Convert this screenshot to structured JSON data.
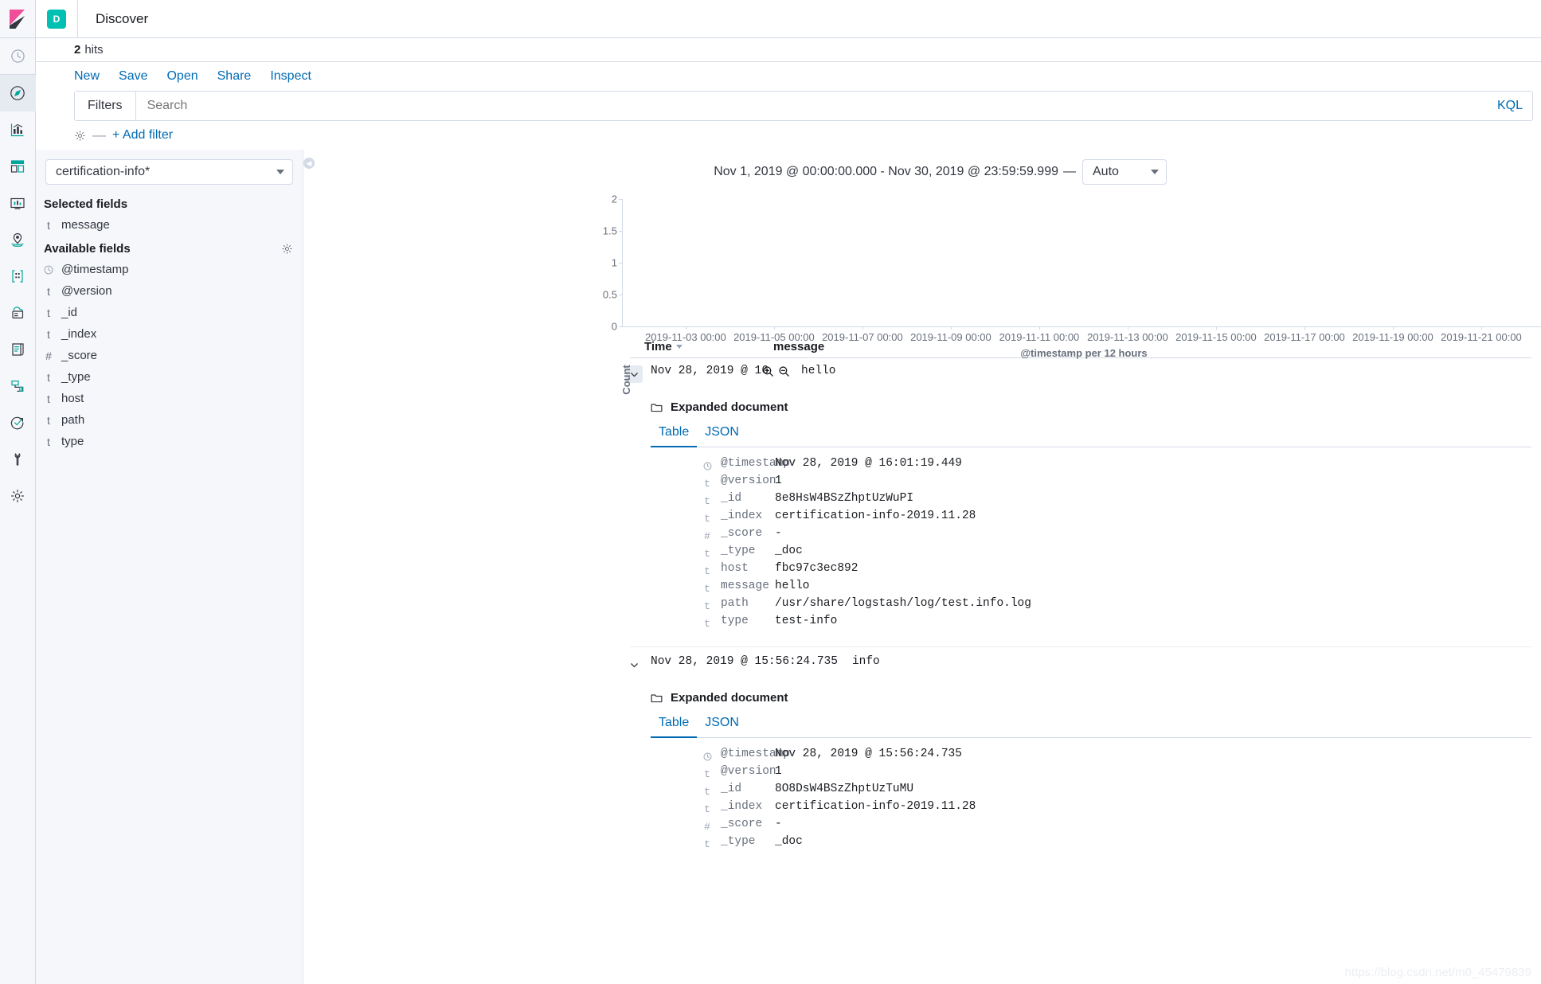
{
  "app": {
    "logo": "kibana-logo",
    "space_badge": "D",
    "title": "Discover"
  },
  "hits": {
    "count": "2",
    "label": "hits"
  },
  "actions": [
    {
      "label": "New",
      "name": "new"
    },
    {
      "label": "Save",
      "name": "save"
    },
    {
      "label": "Open",
      "name": "open"
    },
    {
      "label": "Share",
      "name": "share"
    },
    {
      "label": "Inspect",
      "name": "inspect"
    }
  ],
  "query_bar": {
    "filters_label": "Filters",
    "search_placeholder": "Search",
    "search_value": "",
    "language_label": "KQL"
  },
  "filter_row": {
    "add_filter_label": "+ Add filter",
    "dash": "—"
  },
  "sidebar": {
    "index_pattern": "certification-info*",
    "selected_fields_title": "Selected fields",
    "selected_fields": [
      {
        "type": "t",
        "name": "message"
      }
    ],
    "available_fields_title": "Available fields",
    "available_fields": [
      {
        "type": "clock",
        "name": "@timestamp"
      },
      {
        "type": "t",
        "name": "@version"
      },
      {
        "type": "t",
        "name": "_id"
      },
      {
        "type": "t",
        "name": "_index"
      },
      {
        "type": "#",
        "name": "_score"
      },
      {
        "type": "t",
        "name": "_type"
      },
      {
        "type": "t",
        "name": "host"
      },
      {
        "type": "t",
        "name": "path"
      },
      {
        "type": "t",
        "name": "type"
      }
    ]
  },
  "timepicker": {
    "range": "Nov 1, 2019 @ 00:00:00.000 - Nov 30, 2019 @ 23:59:59.999",
    "separator": "—",
    "interval": "Auto"
  },
  "chart_data": {
    "type": "bar",
    "title": "",
    "xlabel": "@timestamp per 12 hours",
    "ylabel": "Count",
    "ylim": [
      0,
      2
    ],
    "yticks": [
      "0",
      "0.5",
      "1",
      "1.5",
      "2"
    ],
    "ytick_values": [
      0,
      0.5,
      1,
      1.5,
      2
    ],
    "xticks": [
      "2019-11-03 00:00",
      "2019-11-05 00:00",
      "2019-11-07 00:00",
      "2019-11-09 00:00",
      "2019-11-11 00:00",
      "2019-11-13 00:00",
      "2019-11-15 00:00",
      "2019-11-17 00:00",
      "2019-11-19 00:00",
      "2019-11-21 00:00"
    ],
    "categories": [],
    "values": [],
    "grid": false,
    "legend": "none"
  },
  "doc_table": {
    "columns": [
      {
        "label": "Time",
        "name": "time",
        "sorted": true
      },
      {
        "label": "message",
        "name": "message",
        "sorted": false
      }
    ],
    "rows": [
      {
        "time_display": "Nov 28, 2019 @ 16:01:1",
        "message": "hello",
        "show_filter_icons": true,
        "expanded": {
          "title": "Expanded document",
          "tabs": [
            {
              "label": "Table",
              "active": true
            },
            {
              "label": "JSON",
              "active": false
            }
          ],
          "fields": [
            {
              "icon": "clock",
              "name": "@timestamp",
              "value": "Nov 28, 2019 @ 16:01:19.449"
            },
            {
              "icon": "t",
              "name": "@version",
              "value": "1"
            },
            {
              "icon": "t",
              "name": "_id",
              "value": "8e8HsW4BSzZhptUzWuPI"
            },
            {
              "icon": "t",
              "name": "_index",
              "value": "certification-info-2019.11.28"
            },
            {
              "icon": "#",
              "name": "_score",
              "value": "-"
            },
            {
              "icon": "t",
              "name": "_type",
              "value": "_doc"
            },
            {
              "icon": "t",
              "name": "host",
              "value": "fbc97c3ec892"
            },
            {
              "icon": "t",
              "name": "message",
              "value": "hello"
            },
            {
              "icon": "t",
              "name": "path",
              "value": "/usr/share/logstash/log/test.info.log"
            },
            {
              "icon": "t",
              "name": "type",
              "value": "test-info"
            }
          ]
        }
      },
      {
        "time_display": "Nov 28, 2019 @ 15:56:24.735",
        "message": "info",
        "show_filter_icons": false,
        "expanded": {
          "title": "Expanded document",
          "tabs": [
            {
              "label": "Table",
              "active": true
            },
            {
              "label": "JSON",
              "active": false
            }
          ],
          "fields": [
            {
              "icon": "clock",
              "name": "@timestamp",
              "value": "Nov 28, 2019 @ 15:56:24.735"
            },
            {
              "icon": "t",
              "name": "@version",
              "value": "1"
            },
            {
              "icon": "t",
              "name": "_id",
              "value": "8O8DsW4BSzZhptUzTuMU"
            },
            {
              "icon": "t",
              "name": "_index",
              "value": "certification-info-2019.11.28"
            },
            {
              "icon": "#",
              "name": "_score",
              "value": "-"
            },
            {
              "icon": "t",
              "name": "_type",
              "value": "_doc"
            }
          ]
        }
      }
    ]
  },
  "watermark": "https://blog.csdn.net/m0_45479839"
}
